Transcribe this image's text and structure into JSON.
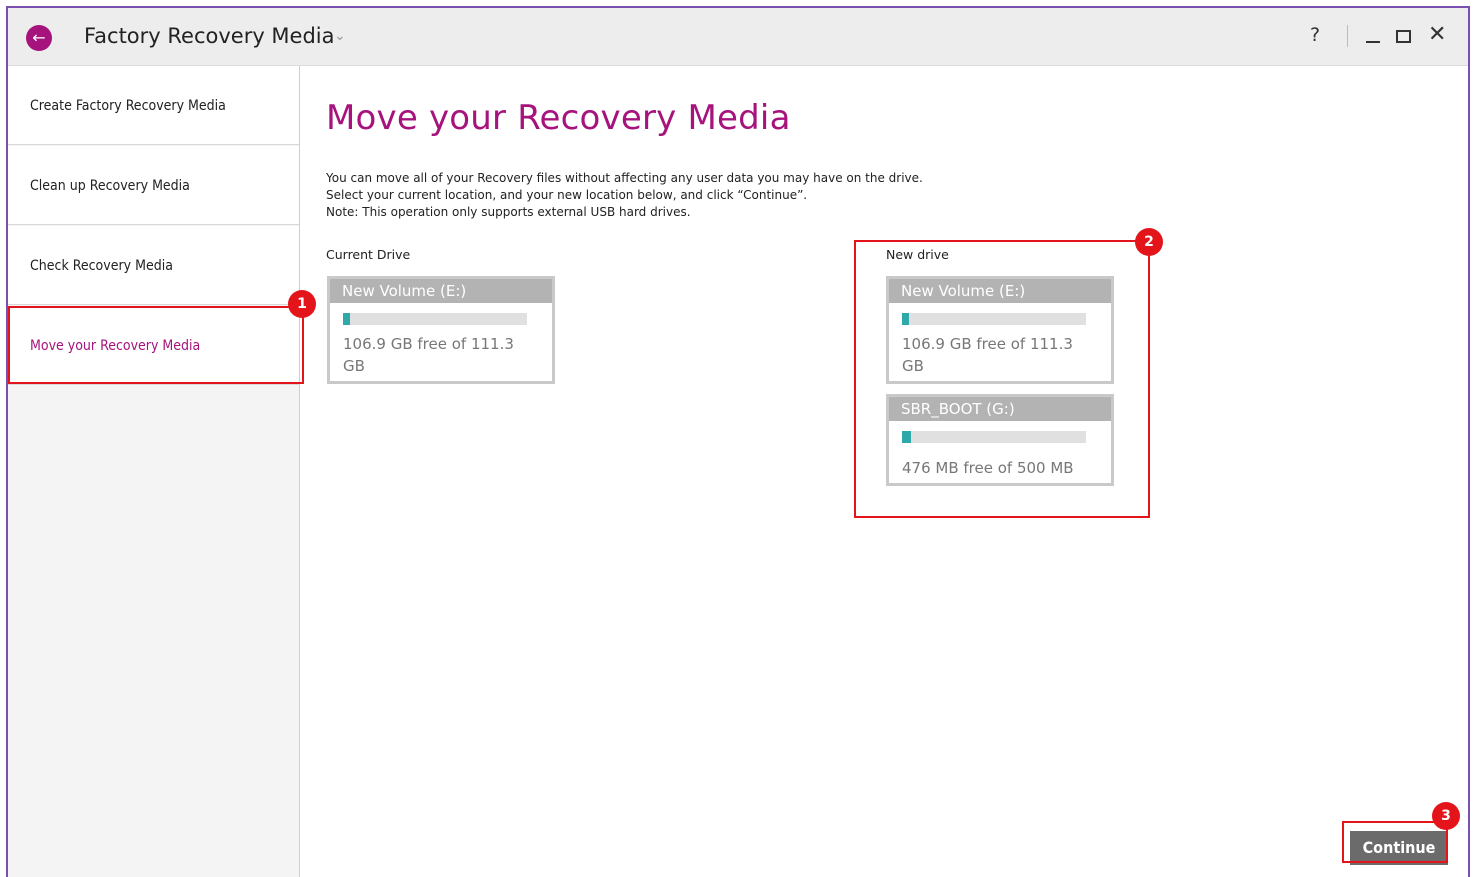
{
  "app": {
    "title": "Factory Recovery Media",
    "help_label": "?",
    "close_label": "✕",
    "back_label": "←"
  },
  "sidebar": {
    "items": [
      {
        "label": "Create Factory Recovery Media"
      },
      {
        "label": "Clean up Recovery Media"
      },
      {
        "label": "Check Recovery Media"
      },
      {
        "label": "Move your Recovery Media"
      }
    ]
  },
  "main": {
    "title": "Move your Recovery Media",
    "description": [
      "You can move all of your Recovery files without affecting any user data you may have on the drive.",
      "Select your current location, and your new location below, and click “Continue”.",
      "Note: This operation only supports external USB hard drives."
    ],
    "current_drive": {
      "label": "Current Drive",
      "drives": [
        {
          "name": "New Volume (E:)",
          "free": "106.9 GB free of 111.3 GB",
          "used_fraction": 0.04
        }
      ]
    },
    "new_drive": {
      "label": "New drive",
      "drives": [
        {
          "name": "New Volume (E:)",
          "free": "106.9 GB free of 111.3 GB",
          "used_fraction": 0.04
        },
        {
          "name": "SBR_BOOT (G:)",
          "free": "476 MB free of 500 MB",
          "used_fraction": 0.05
        }
      ]
    },
    "continue_label": "Continue"
  },
  "annotations": {
    "badges": [
      "1",
      "2",
      "3"
    ]
  },
  "colors": {
    "accent": "#a6137c",
    "callout": "#e3151a",
    "bar_fill": "#2ea8a8"
  }
}
